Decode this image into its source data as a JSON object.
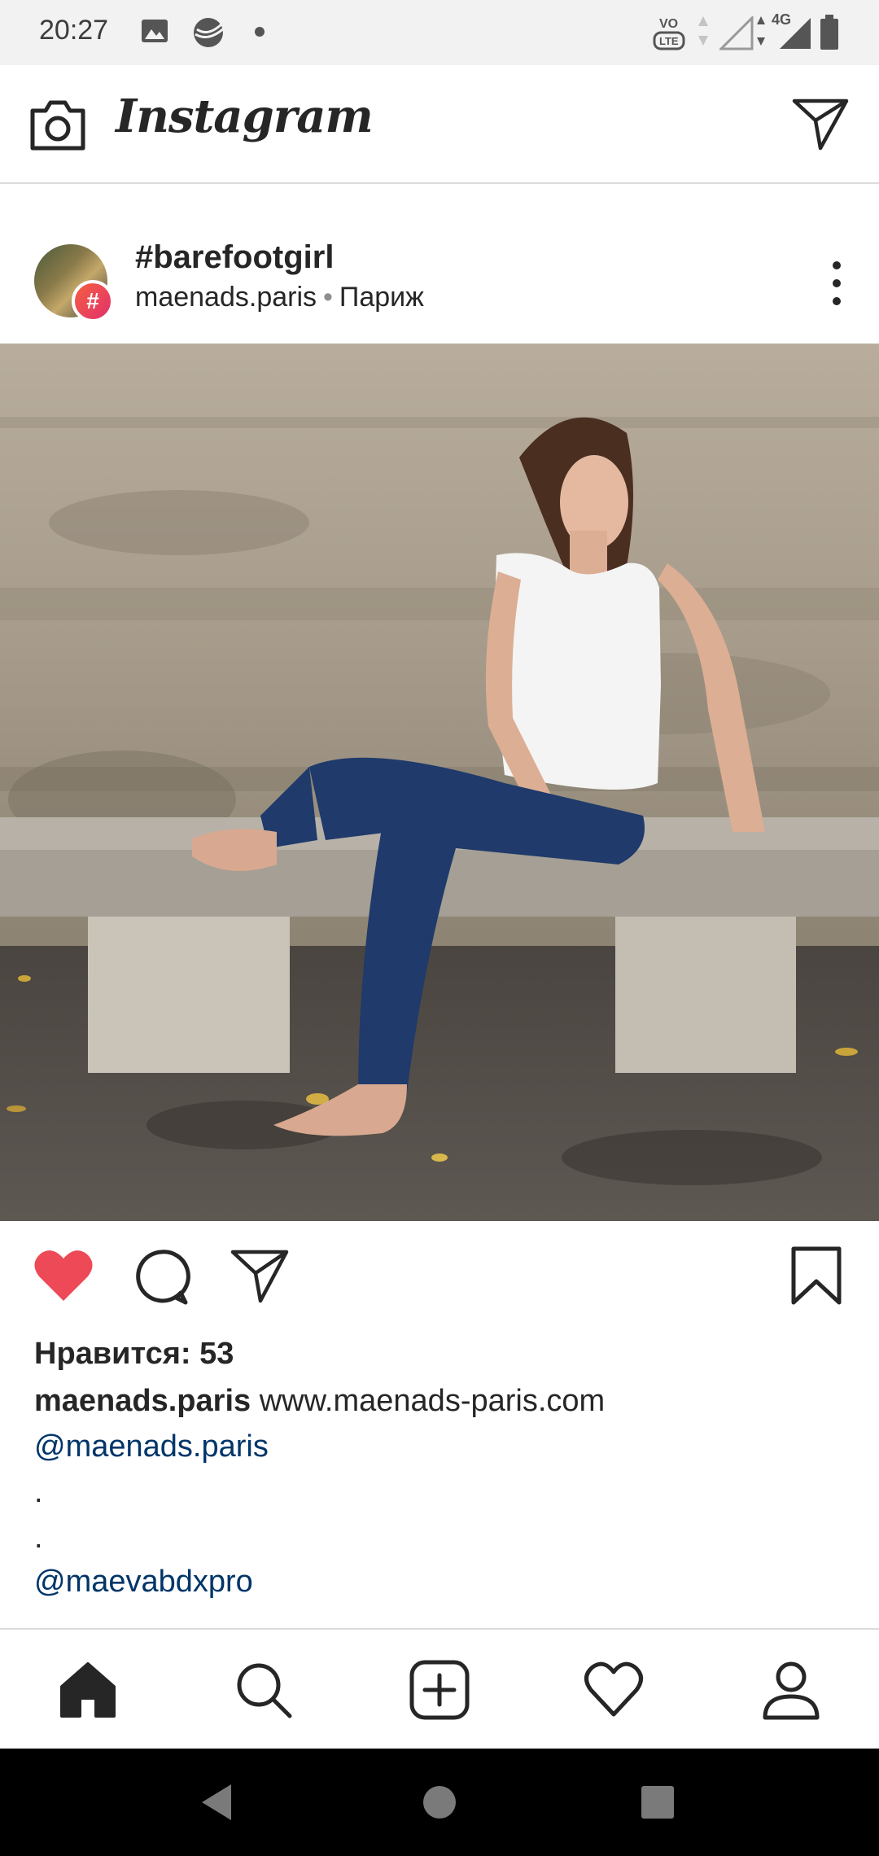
{
  "status_bar": {
    "time": "20:27",
    "network_label": "4G",
    "volte_label": "VoLTE"
  },
  "header": {
    "app_name": "Instagram"
  },
  "post": {
    "title": "#barefootgirl",
    "username": "maenads.paris",
    "location": "Париж",
    "badge_symbol": "#",
    "likes_text": "Нравится: 53",
    "caption_user": "maenads.paris",
    "caption_text": "www.maenads-paris.com",
    "mention_1": "@maenads.paris",
    "dot_1": ".",
    "dot_2": ".",
    "mention_2": "@maevabdxpro",
    "liked": true
  },
  "colors": {
    "like_red": "#ed4956",
    "link_blue": "#003569",
    "text_dark": "#262626",
    "meta_gray": "#8e8e8e"
  },
  "icons": {
    "header": [
      "camera-icon",
      "direct-message-icon"
    ],
    "actions": [
      "heart-icon",
      "comment-icon",
      "share-icon",
      "bookmark-icon"
    ],
    "nav": [
      "home-icon",
      "search-icon",
      "add-post-icon",
      "activity-heart-icon",
      "profile-icon"
    ],
    "system": [
      "back-icon",
      "home-circle-icon",
      "recents-icon"
    ]
  }
}
